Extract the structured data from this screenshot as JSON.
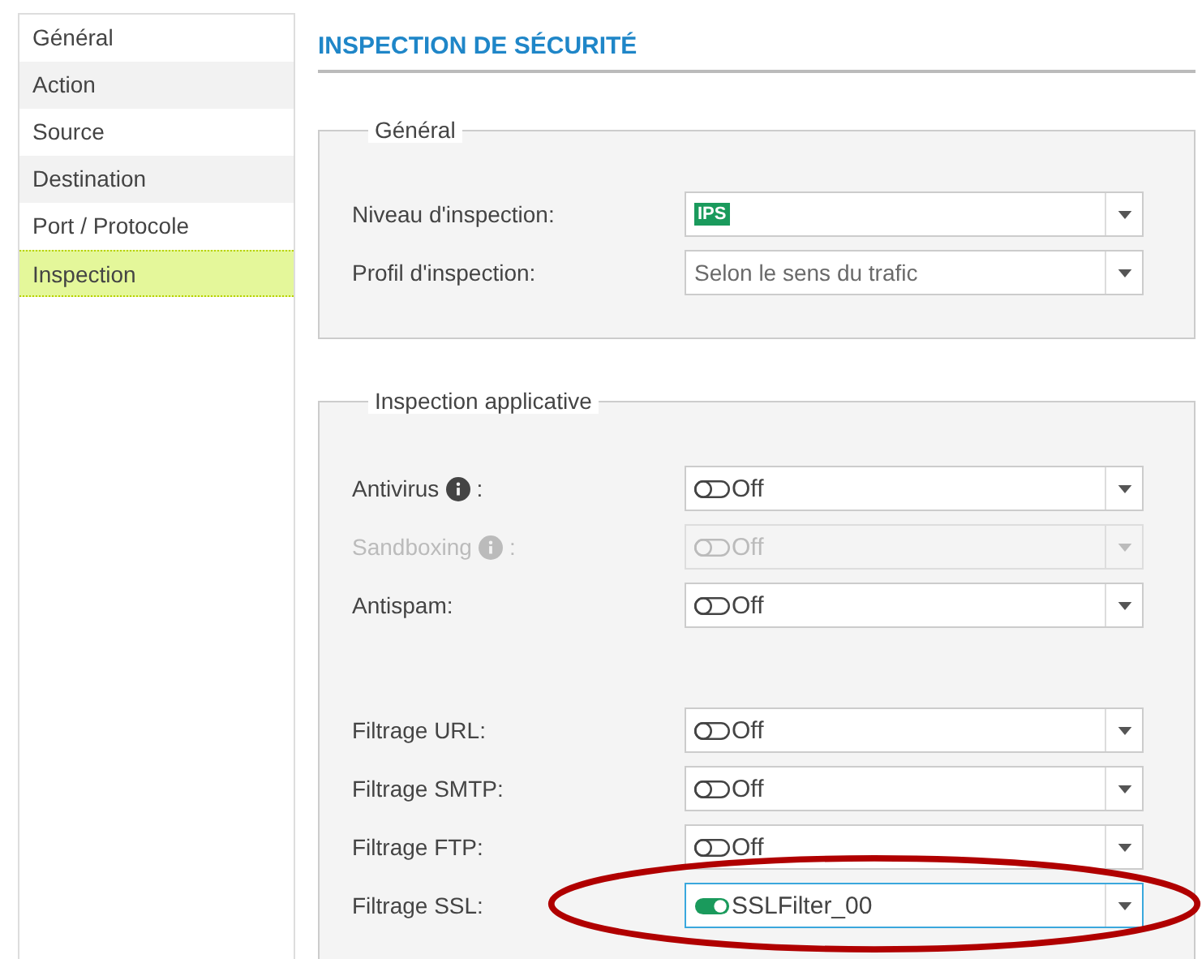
{
  "sidebar": {
    "items": [
      {
        "label": "Général",
        "selected": false
      },
      {
        "label": "Action",
        "selected": false
      },
      {
        "label": "Source",
        "selected": false
      },
      {
        "label": "Destination",
        "selected": false
      },
      {
        "label": "Port / Protocole",
        "selected": false
      },
      {
        "label": "Inspection",
        "selected": true
      }
    ]
  },
  "title": "INSPECTION DE SÉCURITÉ",
  "sections": [
    {
      "legend": "Général",
      "groups": [
        [
          {
            "label": "Niveau d'inspection:",
            "kind": "badge",
            "value": "IPS",
            "disabled": false,
            "info": false,
            "focused": false
          },
          {
            "label": "Profil d'inspection:",
            "kind": "text",
            "value": "Selon le sens du trafic",
            "disabled": false,
            "info": false,
            "focused": false
          }
        ]
      ]
    },
    {
      "legend": "Inspection applicative",
      "groups": [
        [
          {
            "label": "Antivirus",
            "suffix": ":",
            "kind": "toggle",
            "on": false,
            "value": "Off",
            "disabled": false,
            "info": true,
            "focused": false
          },
          {
            "label": "Sandboxing",
            "suffix": ":",
            "kind": "toggle",
            "on": false,
            "value": "Off",
            "disabled": true,
            "info": true,
            "focused": false
          },
          {
            "label": "Antispam:",
            "kind": "toggle",
            "on": false,
            "value": "Off",
            "disabled": false,
            "info": false,
            "focused": false
          }
        ],
        [
          {
            "label": "Filtrage URL:",
            "kind": "toggle",
            "on": false,
            "value": "Off",
            "disabled": false,
            "info": false,
            "focused": false
          },
          {
            "label": "Filtrage SMTP:",
            "kind": "toggle",
            "on": false,
            "value": "Off",
            "disabled": false,
            "info": false,
            "focused": false
          },
          {
            "label": "Filtrage FTP:",
            "kind": "toggle",
            "on": false,
            "value": "Off",
            "disabled": false,
            "info": false,
            "focused": false
          },
          {
            "label": "Filtrage SSL:",
            "kind": "toggle",
            "on": true,
            "value": "SSLFilter_00",
            "disabled": false,
            "info": false,
            "focused": true
          }
        ]
      ]
    }
  ],
  "annotation": {
    "kind": "ellipse"
  }
}
